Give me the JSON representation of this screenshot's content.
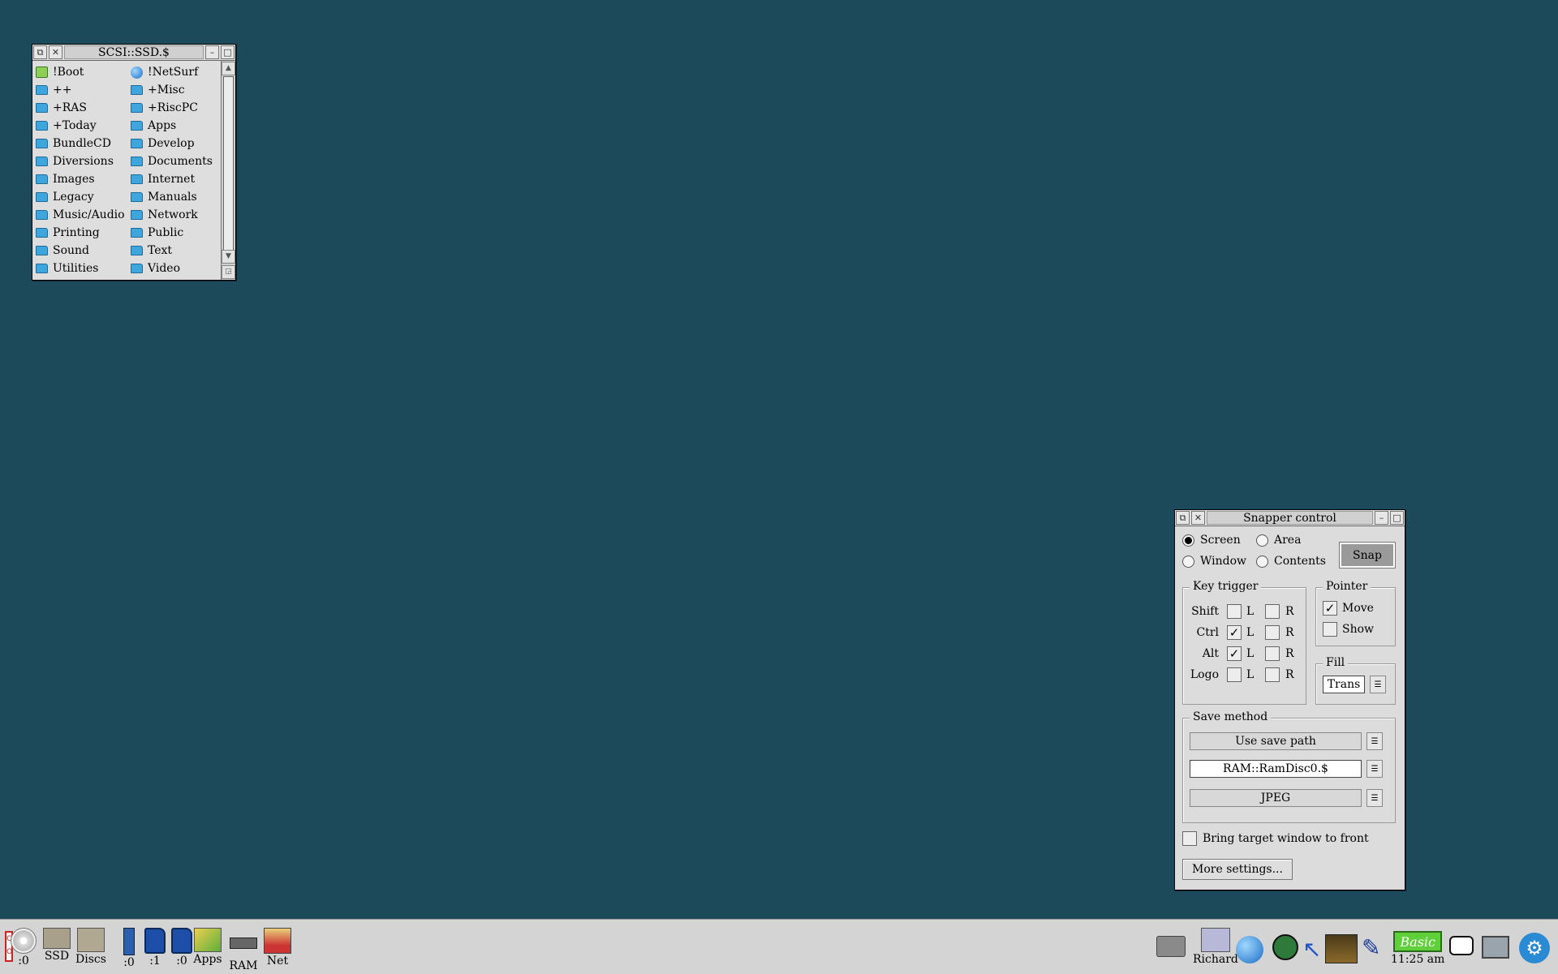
{
  "filer": {
    "title": "SCSI::SSD.$",
    "items": [
      {
        "name": "!Boot",
        "icon": "boot-app-icon"
      },
      {
        "name": "!NetSurf",
        "icon": "globe-app-icon"
      },
      {
        "name": "++",
        "icon": "folder-icon"
      },
      {
        "name": "+Misc",
        "icon": "folder-icon"
      },
      {
        "name": "+RAS",
        "icon": "folder-icon"
      },
      {
        "name": "+RiscPC",
        "icon": "folder-icon"
      },
      {
        "name": "+Today",
        "icon": "folder-icon"
      },
      {
        "name": "Apps",
        "icon": "folder-icon"
      },
      {
        "name": "BundleCD",
        "icon": "folder-icon"
      },
      {
        "name": "Develop",
        "icon": "folder-icon"
      },
      {
        "name": "Diversions",
        "icon": "folder-icon"
      },
      {
        "name": "Documents",
        "icon": "folder-icon"
      },
      {
        "name": "Images",
        "icon": "folder-icon"
      },
      {
        "name": "Internet",
        "icon": "folder-icon"
      },
      {
        "name": "Legacy",
        "icon": "folder-icon"
      },
      {
        "name": "Manuals",
        "icon": "folder-icon"
      },
      {
        "name": "Music/Audio",
        "icon": "folder-icon"
      },
      {
        "name": "Network",
        "icon": "folder-icon"
      },
      {
        "name": "Printing",
        "icon": "folder-icon"
      },
      {
        "name": "Public",
        "icon": "folder-icon"
      },
      {
        "name": "Sound",
        "icon": "folder-icon"
      },
      {
        "name": "Text",
        "icon": "folder-icon"
      },
      {
        "name": "Utilities",
        "icon": "folder-icon"
      },
      {
        "name": "Video",
        "icon": "folder-icon"
      }
    ]
  },
  "snapper": {
    "title": "Snapper control",
    "modes": {
      "screen": "Screen",
      "area": "Area",
      "window": "Window",
      "contents": "Contents",
      "selected": "Screen"
    },
    "snap_label": "Snap",
    "key_trigger": {
      "label": "Key trigger",
      "rows": [
        {
          "key": "Shift",
          "left": false,
          "right": false
        },
        {
          "key": "Ctrl",
          "left": true,
          "right": false
        },
        {
          "key": "Alt",
          "left": true,
          "right": false
        },
        {
          "key": "Logo",
          "left": false,
          "right": false
        }
      ],
      "left_label": "L",
      "right_label": "R"
    },
    "pointer": {
      "label": "Pointer",
      "move": "Move",
      "move_checked": true,
      "show": "Show",
      "show_checked": false
    },
    "fill": {
      "label": "Fill",
      "value": "Trans"
    },
    "save_method": {
      "label": "Save method",
      "method": "Use save path",
      "path": "RAM::RamDisc0.$",
      "format": "JPEG"
    },
    "bring_to_front": {
      "label": "Bring target window to front",
      "checked": false
    },
    "more_settings": "More settings..."
  },
  "iconbar": {
    "left": [
      {
        "label": ":0",
        "icon": "cd-drive-icon"
      },
      {
        "label": "SSD",
        "icon": "hard-disc-icon"
      },
      {
        "label": "Discs",
        "icon": "discs-icon"
      },
      {
        "label": ":0",
        "icon": "usb-drive-icon"
      },
      {
        "label": ":1",
        "icon": "sd-card-icon"
      },
      {
        "label": ":0",
        "icon": "sd-card-icon"
      },
      {
        "label": "Apps",
        "icon": "apps-icon"
      },
      {
        "label": "RAM",
        "icon": "ram-disc-icon"
      },
      {
        "label": "Net",
        "icon": "network-icon"
      }
    ],
    "right": {
      "user_label": "Richard",
      "basic_label": "Basic",
      "time": "11:25 am"
    }
  }
}
